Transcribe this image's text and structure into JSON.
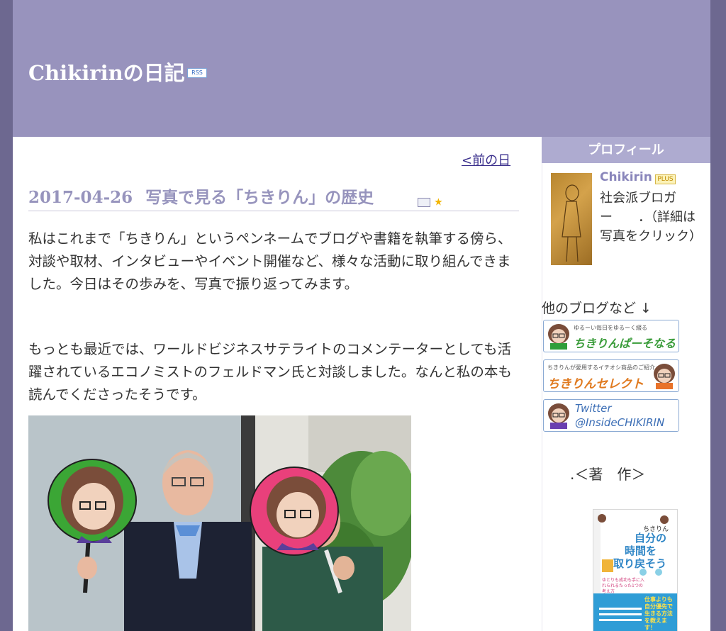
{
  "header": {
    "site_title": "Chikirinの日記",
    "rss_label": "RSS"
  },
  "main": {
    "prev_link": "<前の日",
    "entry_date": "2017-04-26",
    "entry_title": "写真で見る「ちきりん」の歴史",
    "paragraphs": [
      "私はこれまで「ちきりん」というペンネームでブログや書籍を執筆する傍ら、対談や取材、インタビューやイベント開催など、様々な活動に取り組んできました。今日はその歩みを、写真で振り返ってみます。",
      "もっとも最近では、ワールドビジネスサテライトのコメンテーターとしても活躍されているエコノミストのフェルドマン氏と対談しました。なんと私の本も読んでくださったそうです。"
    ]
  },
  "sidebar": {
    "profile_heading": "プロフィール",
    "profile_name": "Chikirin",
    "plus_label": "PLUS",
    "profile_desc": "社会派ブロガー　　．（詳細は写真をクリック）",
    "other_blogs": "他のブログなど ↓",
    "banners": [
      {
        "small": "ゆるーい毎日をゆるーく綴る",
        "big": "ちきりんぱーそなる"
      },
      {
        "small": "ちきりんが愛用するイチオシ商品のご紹介",
        "big": "ちきりんセレクト"
      },
      {
        "line1": "Twitter",
        "line2": "@InsideCHIKIRIN"
      }
    ],
    "works_heading": ".＜著　作＞",
    "book": {
      "author": "ちきりん",
      "title_lines": [
        "自分の",
        "時間を",
        "取り戻そう"
      ],
      "sub": "ゆとりも成功も手に入れられるたった1つの考え方",
      "catch": "仕事よりも自分優先で生きる方法を教えます！"
    }
  }
}
